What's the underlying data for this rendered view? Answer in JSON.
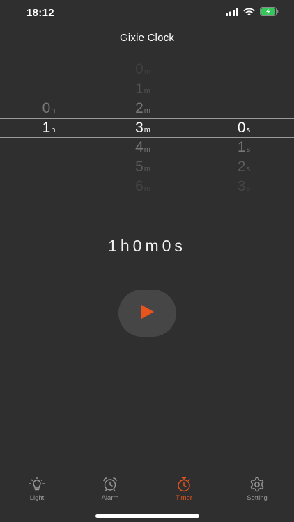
{
  "status_bar": {
    "time": "18:12"
  },
  "header": {
    "title": "Gixie Clock"
  },
  "picker": {
    "hours": {
      "unit": "h",
      "items": [
        {
          "slot": "r-1",
          "value": "0"
        },
        {
          "slot": "r0",
          "value": "1"
        }
      ]
    },
    "minutes": {
      "unit": "m",
      "items": [
        {
          "slot": "r-3",
          "value": "0"
        },
        {
          "slot": "r-2",
          "value": "1"
        },
        {
          "slot": "r-1",
          "value": "2"
        },
        {
          "slot": "r0",
          "value": "3"
        },
        {
          "slot": "r1",
          "value": "4"
        },
        {
          "slot": "r2",
          "value": "5"
        },
        {
          "slot": "r3",
          "value": "6"
        }
      ]
    },
    "seconds": {
      "unit": "s",
      "items": [
        {
          "slot": "r0",
          "value": "0"
        },
        {
          "slot": "r1",
          "value": "1"
        },
        {
          "slot": "r2",
          "value": "2"
        },
        {
          "slot": "r3",
          "value": "3"
        }
      ]
    }
  },
  "countdown": {
    "text": "1h0m0s"
  },
  "colors": {
    "accent": "#e8541e",
    "background": "#2f2f2f",
    "tab_inactive": "#9a9a9a"
  },
  "tabs": [
    {
      "id": "light",
      "label": "Light",
      "icon": "bulb-icon"
    },
    {
      "id": "alarm",
      "label": "Alarm",
      "icon": "alarm-clock-icon"
    },
    {
      "id": "timer",
      "label": "Timer",
      "icon": "stopwatch-icon",
      "active": true
    },
    {
      "id": "setting",
      "label": "Setting",
      "icon": "gear-icon"
    }
  ]
}
